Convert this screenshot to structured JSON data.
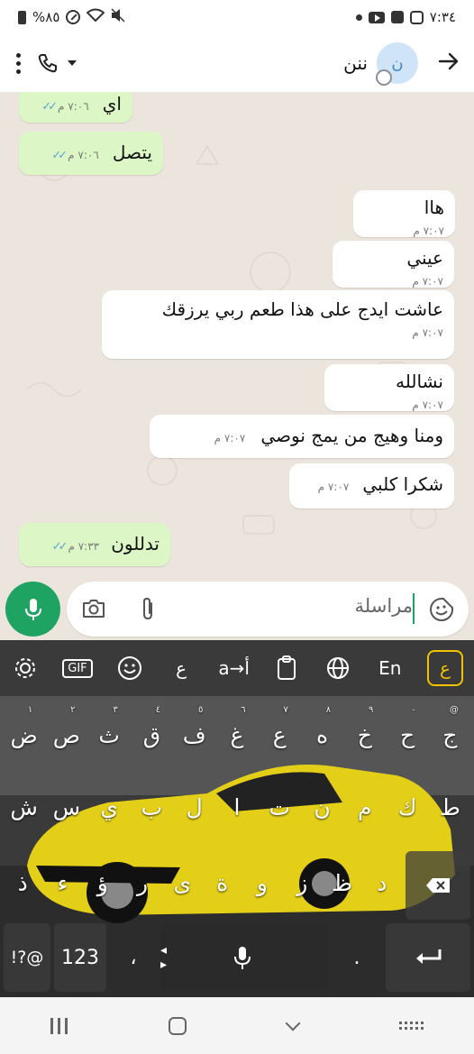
{
  "status_bar": {
    "time": "٧:٣٤",
    "battery": "%٨٥"
  },
  "header": {
    "contact_name": "ننن",
    "avatar_letter": "ن"
  },
  "messages": [
    {
      "text": "اي",
      "time": "٧:٠٦ م",
      "dir": "out"
    },
    {
      "text": "يتصل",
      "time": "٧:٠٦ م",
      "dir": "out"
    },
    {
      "text": "هاا",
      "time": "٧:٠٧ م",
      "dir": "in"
    },
    {
      "text": "عيني",
      "time": "٧:٠٧ م",
      "dir": "in"
    },
    {
      "text": "عاشت ايدج على هذا طعم ربي يرزقك",
      "time": "٧:٠٧ م",
      "dir": "in"
    },
    {
      "text": "نشالله",
      "time": "٧:٠٧ م",
      "dir": "in"
    },
    {
      "text": "ومنا وهيج من يمج نوصي",
      "time": "٧:٠٧ م",
      "dir": "in"
    },
    {
      "text": "شكرا كلبي",
      "time": "٧:٠٧ م",
      "dir": "in"
    },
    {
      "text": "تدللون",
      "time": "٧:٣٣ م",
      "dir": "out"
    }
  ],
  "composer": {
    "placeholder": "مراسلة"
  },
  "keyboard": {
    "toolbar": {
      "logo": "ع",
      "lang": "En",
      "translit": "a→أ",
      "arabic_key": "ع",
      "gif": "GIF"
    },
    "row1": [
      "ض",
      "ص",
      "ث",
      "ق",
      "ف",
      "غ",
      "ع",
      "ه",
      "خ",
      "ح",
      "ج"
    ],
    "row1_hints": [
      "١",
      "٢",
      "٣",
      "٤",
      "٥",
      "٦",
      "٧",
      "٨",
      "٩",
      "٠",
      "@"
    ],
    "row2": [
      "ش",
      "س",
      "ي",
      "ب",
      "ل",
      "ا",
      "ت",
      "ن",
      "م",
      "ك",
      "ط"
    ],
    "row3": [
      "ذ",
      "ء",
      "ؤ",
      "ر",
      "ى",
      "ة",
      "و",
      "ز",
      "ظ",
      "د"
    ],
    "bottom": {
      "sym": "!?@",
      "num": "123",
      "comma": "،",
      "dot": ".",
      "space_arrows": "◂ ▸"
    }
  },
  "colors": {
    "accent": "#1ea362",
    "out_bubble": "#dcf7c5",
    "tick": "#5aa4d6",
    "kb_logo": "#f2c200"
  }
}
